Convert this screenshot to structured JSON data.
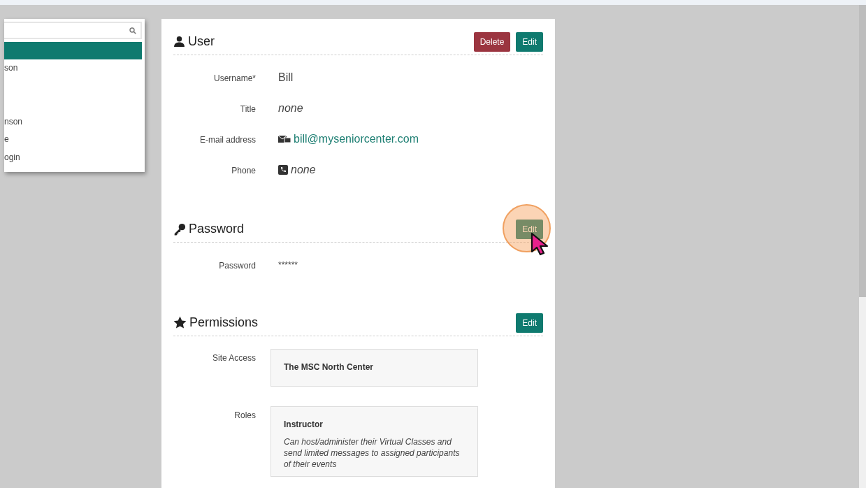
{
  "user_list": {
    "items": [
      {
        "selected": true
      },
      {
        "label": "son",
        "selected": false
      },
      {
        "label": "nson",
        "selected": false
      },
      {
        "label": "e",
        "selected": false
      },
      {
        "label": "ogin",
        "selected": false
      }
    ]
  },
  "sections": [
    {
      "kind": "user",
      "title": "User",
      "buttons": [
        {
          "label": "Delete",
          "kind": "danger",
          "highlighted": false
        },
        {
          "label": "Edit",
          "kind": "primary",
          "highlighted": false
        }
      ],
      "fields": [
        {
          "label": "Username*",
          "value": "Bill",
          "kind": "text"
        },
        {
          "label": "Title",
          "value": "none",
          "kind": "empty"
        },
        {
          "label": "E-mail address",
          "value": "bill@myseniorcenter.com",
          "kind": "email"
        },
        {
          "label": "Phone",
          "value": "none",
          "kind": "phone"
        }
      ]
    },
    {
      "kind": "password",
      "title": "Password",
      "buttons": [
        {
          "label": "Edit",
          "kind": "primary",
          "highlighted": true
        }
      ],
      "fields": [
        {
          "label": "Password",
          "value": "******",
          "kind": "masked"
        }
      ]
    },
    {
      "kind": "permissions",
      "title": "Permissions",
      "buttons": [
        {
          "label": "Edit",
          "kind": "primary",
          "highlighted": false
        }
      ],
      "fields": [
        {
          "label": "Site Access",
          "kind": "box",
          "items": [
            {
              "name": "The MSC North Center"
            }
          ]
        },
        {
          "label": "Roles",
          "kind": "box",
          "items": [
            {
              "name": "Instructor",
              "description": "Can host/administer their Virtual Classes and send limited messages to assigned participants of their events"
            }
          ]
        }
      ]
    }
  ]
}
